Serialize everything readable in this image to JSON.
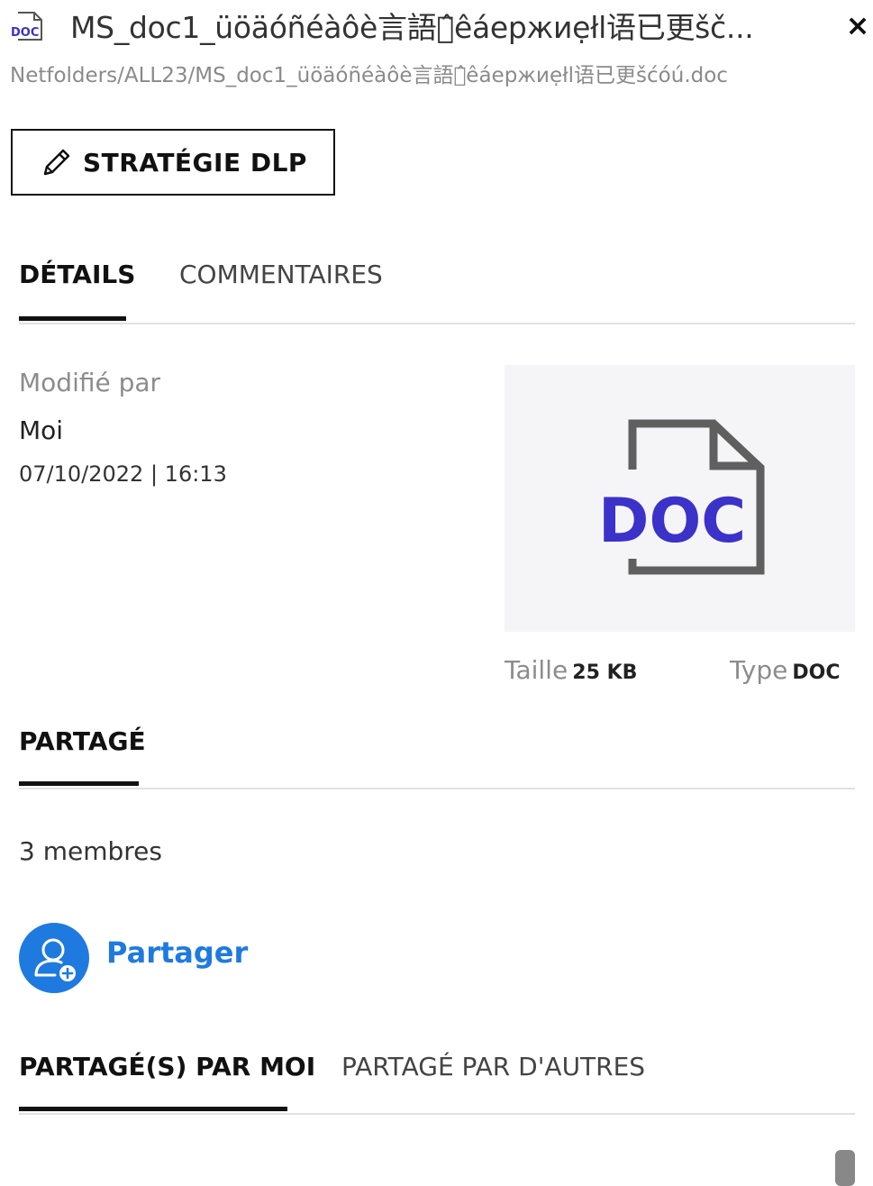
{
  "header": {
    "file_icon": "doc-file-icon",
    "file_icon_text": "DOC",
    "title": "MS_doc1_üöäóñéàôè言語が̂êáepжиẹłl语已更šč...",
    "close_icon": "×",
    "path": "Netfolders/ALL23/MS_doc1_üöäóñéàôè言語が̂êáepжиẹłl语已更šćóú.doc"
  },
  "dlp": {
    "label": "STRATÉGIE DLP",
    "icon": "pencil-icon"
  },
  "tabs": {
    "details": "DÉTAILS",
    "comments": "COMMENTAIRES"
  },
  "details": {
    "modified_by_label": "Modifié par",
    "modified_by": "Moi",
    "modified_date": "07/10/2022 | 16:13",
    "preview_text": "DOC",
    "size_label": "Taille",
    "size_value": "25 KB",
    "type_label": "Type",
    "type_value": "DOC"
  },
  "sharing": {
    "heading": "PARTAGÉ",
    "members": "3 membres",
    "share_label": "Partager",
    "share_icon": "add-user-icon",
    "tab_by_me": "PARTAGÉ(S) PAR MOI",
    "tab_by_others": "PARTAGÉ PAR D'AUTRES"
  },
  "colors": {
    "accent": "#1f7ae0",
    "doc_purple": "#3b32c9",
    "doc_outline": "#5f5f5f",
    "preview_bg": "#f5f5f7"
  }
}
